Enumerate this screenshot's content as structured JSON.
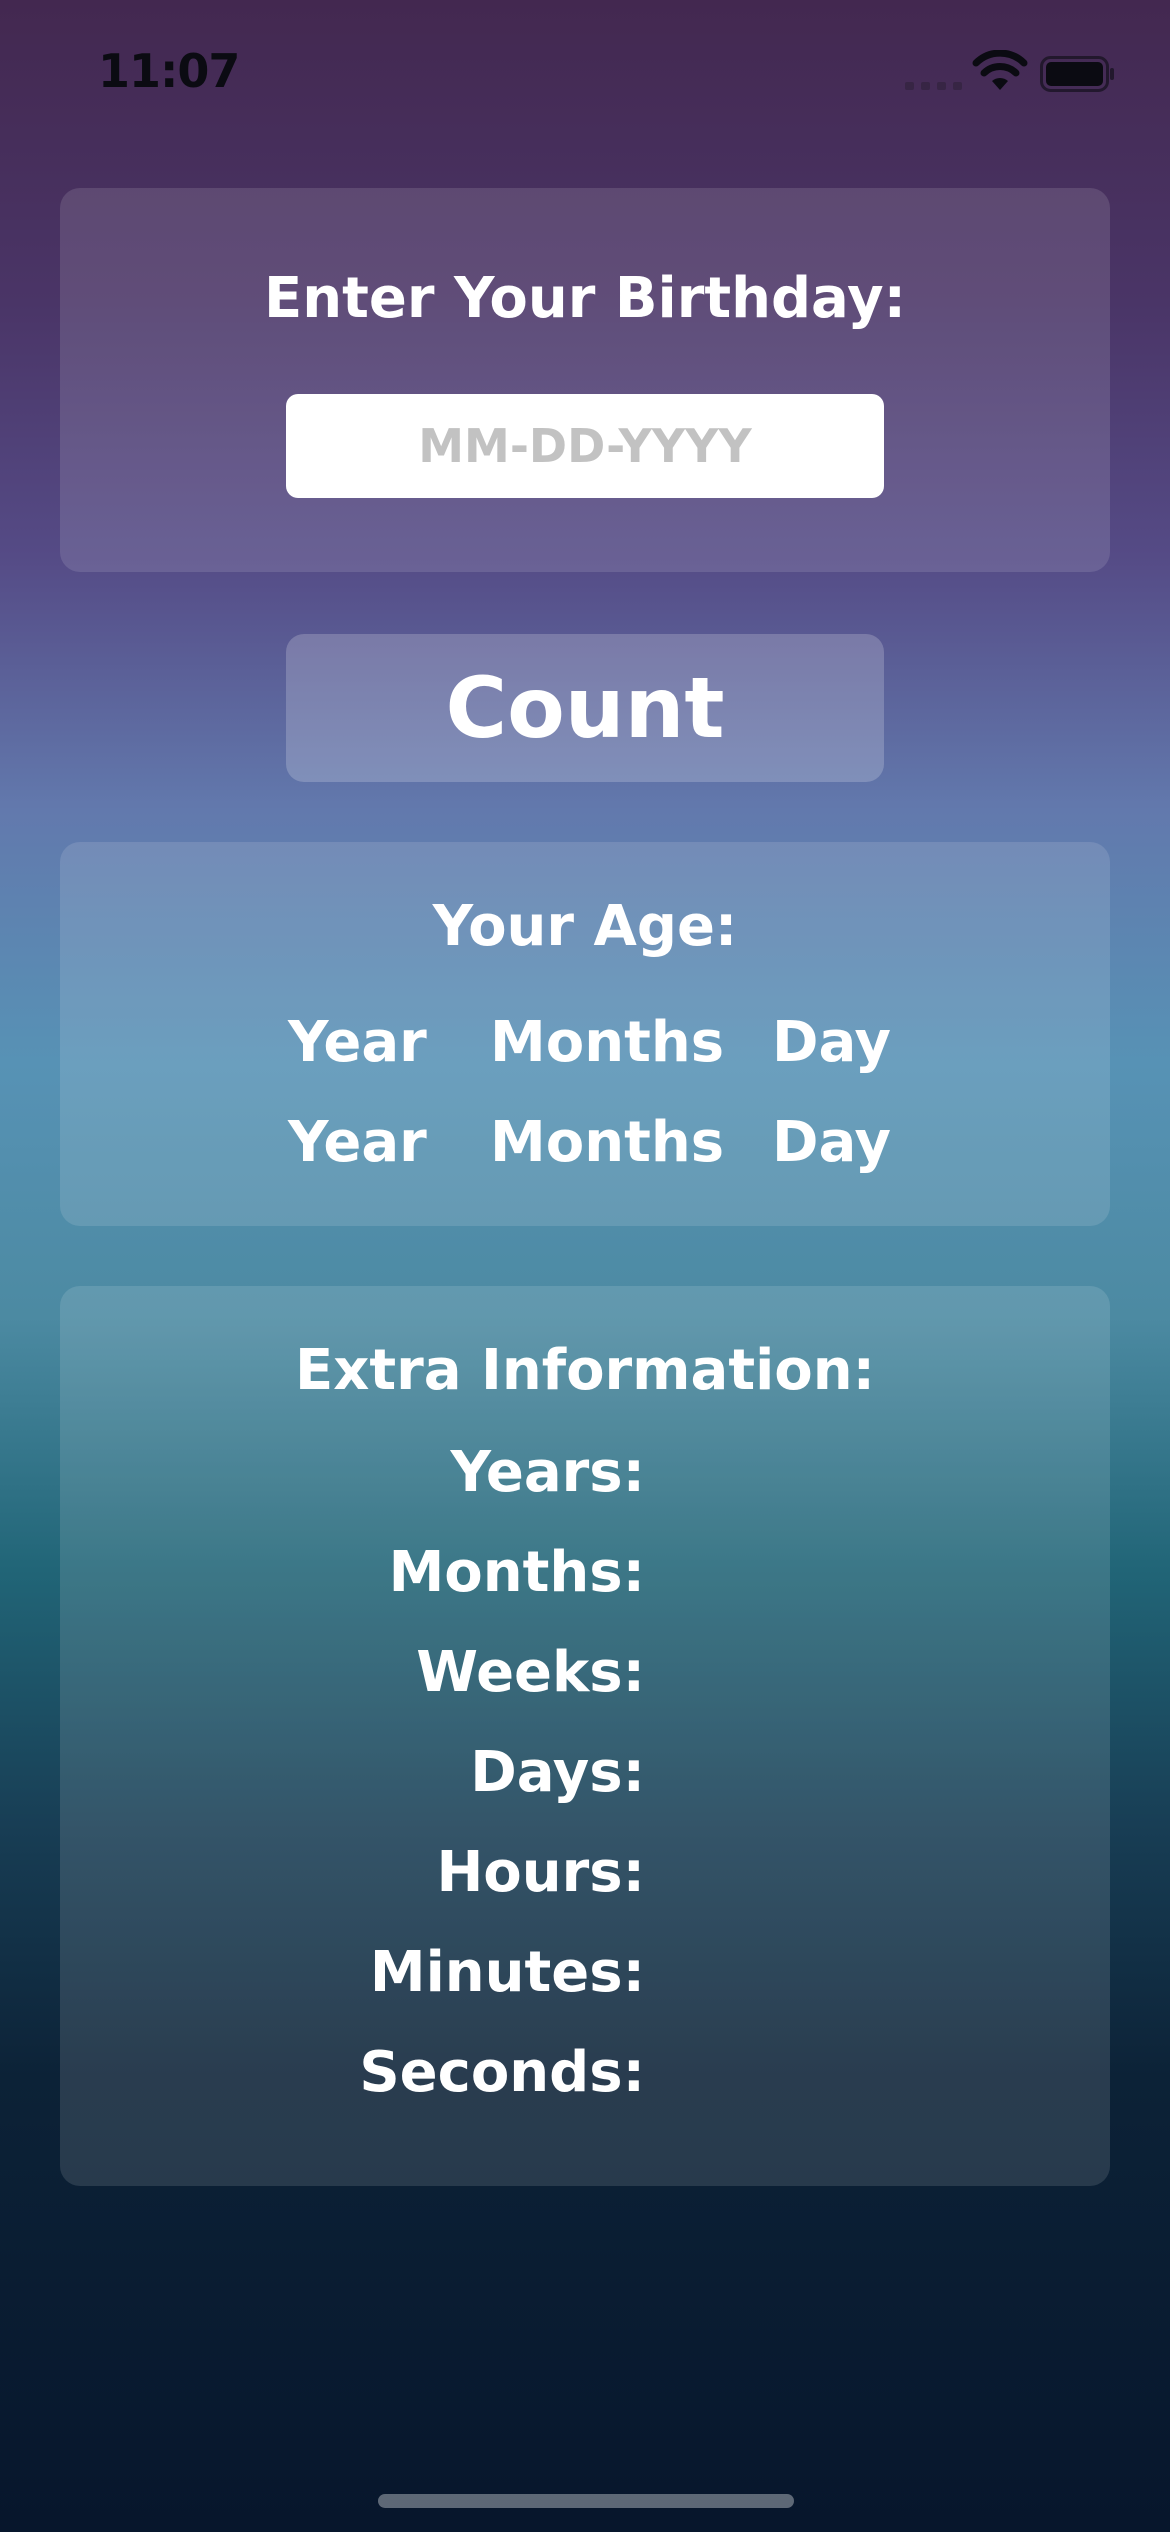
{
  "status_bar": {
    "time": "11:07",
    "icons": [
      "signal-icon",
      "wifi-icon",
      "battery-icon"
    ]
  },
  "birthday": {
    "title": "Enter Your Birthday:",
    "input_placeholder": "MM-DD-YYYY",
    "input_value": ""
  },
  "count_button": {
    "label": "Count"
  },
  "age": {
    "title": "Your Age:",
    "rows": [
      {
        "year": "Year",
        "months": "Months",
        "day": "Day"
      },
      {
        "year": "Year",
        "months": "Months",
        "day": "Day"
      }
    ]
  },
  "extra_info": {
    "title": "Extra Information:",
    "labels": [
      "Years:",
      "Months:",
      "Weeks:",
      "Days:",
      "Hours:",
      "Minutes:",
      "Seconds:"
    ]
  },
  "colors": {
    "gradient_top": "#432850",
    "gradient_middle": "#5792b5",
    "gradient_bottom": "#07162c",
    "text": "#ffffff",
    "placeholder": "#c2c2c2"
  }
}
